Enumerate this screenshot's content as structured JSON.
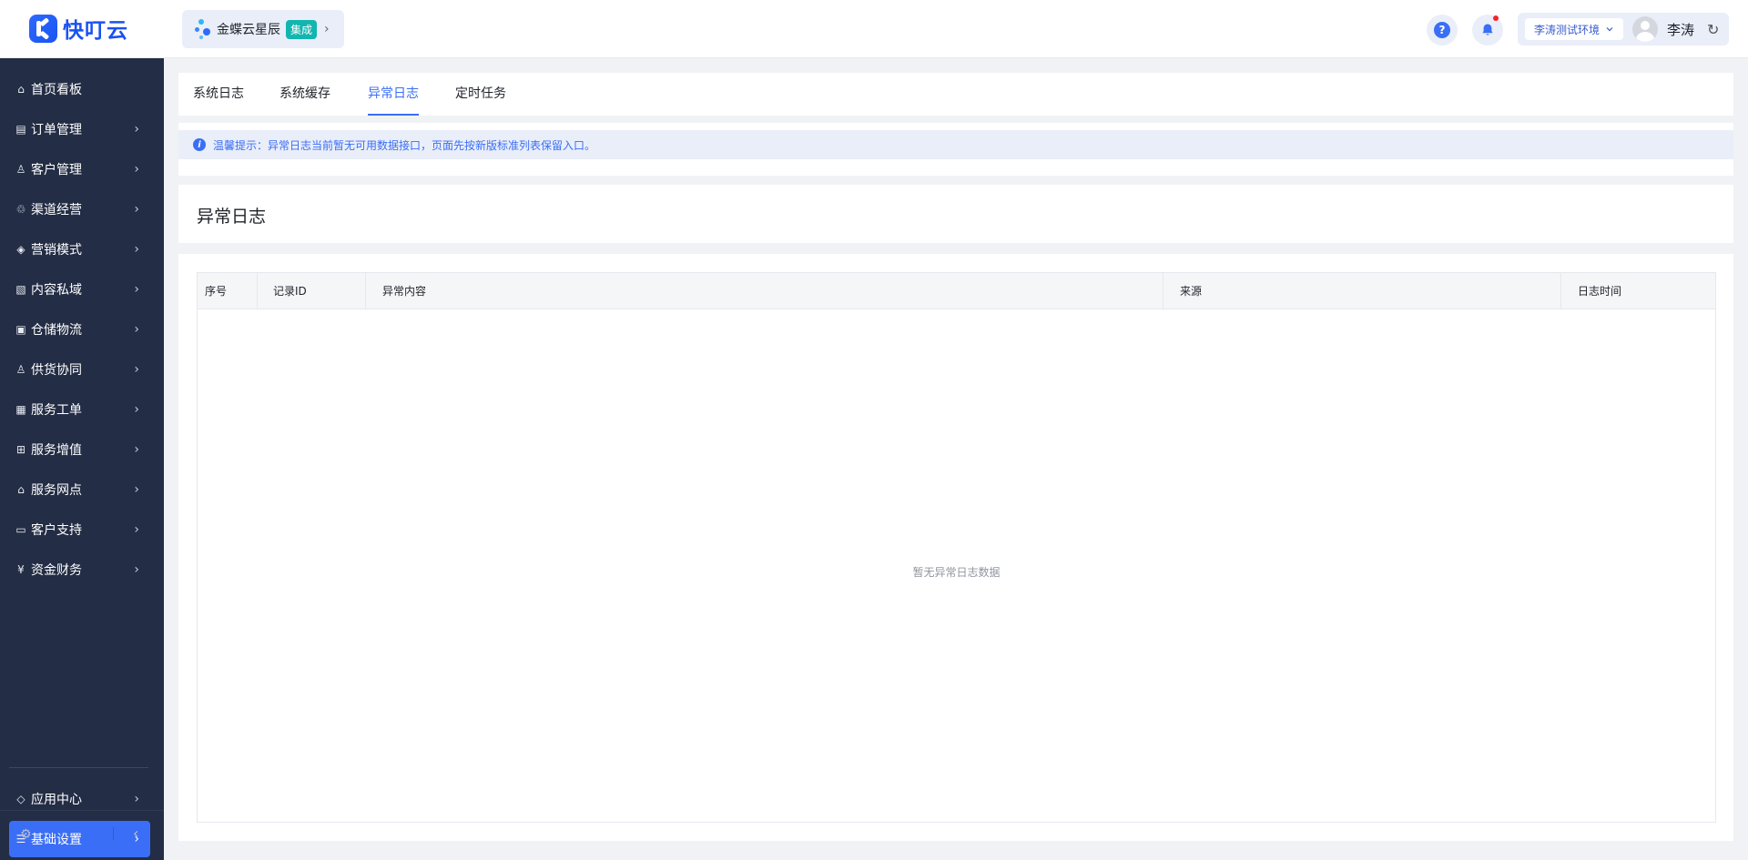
{
  "header": {
    "logo_text": "快叮云",
    "product": {
      "name": "金蝶云星辰",
      "badge": "集成"
    },
    "env": "李涛测试环境",
    "user_name": "李涛",
    "help_glyph": "?"
  },
  "sidebar": {
    "items": [
      {
        "label": "首页看板",
        "icon": "home-icon",
        "glyph": "⌂"
      },
      {
        "label": "订单管理",
        "icon": "clipboard-icon",
        "glyph": "▤"
      },
      {
        "label": "客户管理",
        "icon": "user-icon",
        "glyph": "♙"
      },
      {
        "label": "渠道经营",
        "icon": "channel-icon",
        "glyph": "♲"
      },
      {
        "label": "营销模式",
        "icon": "tag-icon",
        "glyph": "◈"
      },
      {
        "label": "内容私域",
        "icon": "image-icon",
        "glyph": "▧"
      },
      {
        "label": "仓储物流",
        "icon": "box-icon",
        "glyph": "▣"
      },
      {
        "label": "供货协同",
        "icon": "supplier-icon",
        "glyph": "♙"
      },
      {
        "label": "服务工单",
        "icon": "ticket-icon",
        "glyph": "▦"
      },
      {
        "label": "服务增值",
        "icon": "bag-icon",
        "glyph": "⊞"
      },
      {
        "label": "服务网点",
        "icon": "store-icon",
        "glyph": "⌂"
      },
      {
        "label": "客户支持",
        "icon": "support-icon",
        "glyph": "▭"
      },
      {
        "label": "资金财务",
        "icon": "yuan-icon",
        "glyph": "¥"
      }
    ],
    "bottom_items": [
      {
        "label": "应用中心",
        "icon": "cube-icon",
        "glyph": "◇"
      },
      {
        "label": "基础设置",
        "icon": "settings-list-icon",
        "glyph": "☰"
      }
    ]
  },
  "tabs": [
    {
      "label": "系统日志"
    },
    {
      "label": "系统缓存"
    },
    {
      "label": "异常日志"
    },
    {
      "label": "定时任务"
    }
  ],
  "active_tab": "异常日志",
  "notice": "温馨提示：异常日志当前暂无可用数据接口，页面先按新版标准列表保留入口。",
  "page_title": "异常日志",
  "table": {
    "columns": [
      "序号",
      "记录ID",
      "异常内容",
      "来源",
      "日志时间"
    ],
    "rows": [],
    "empty_text": "暂无异常日志数据"
  },
  "colors": {
    "accent": "#3a6ef6",
    "sidebar_bg": "#232d45",
    "badge": "#12b5b0"
  }
}
